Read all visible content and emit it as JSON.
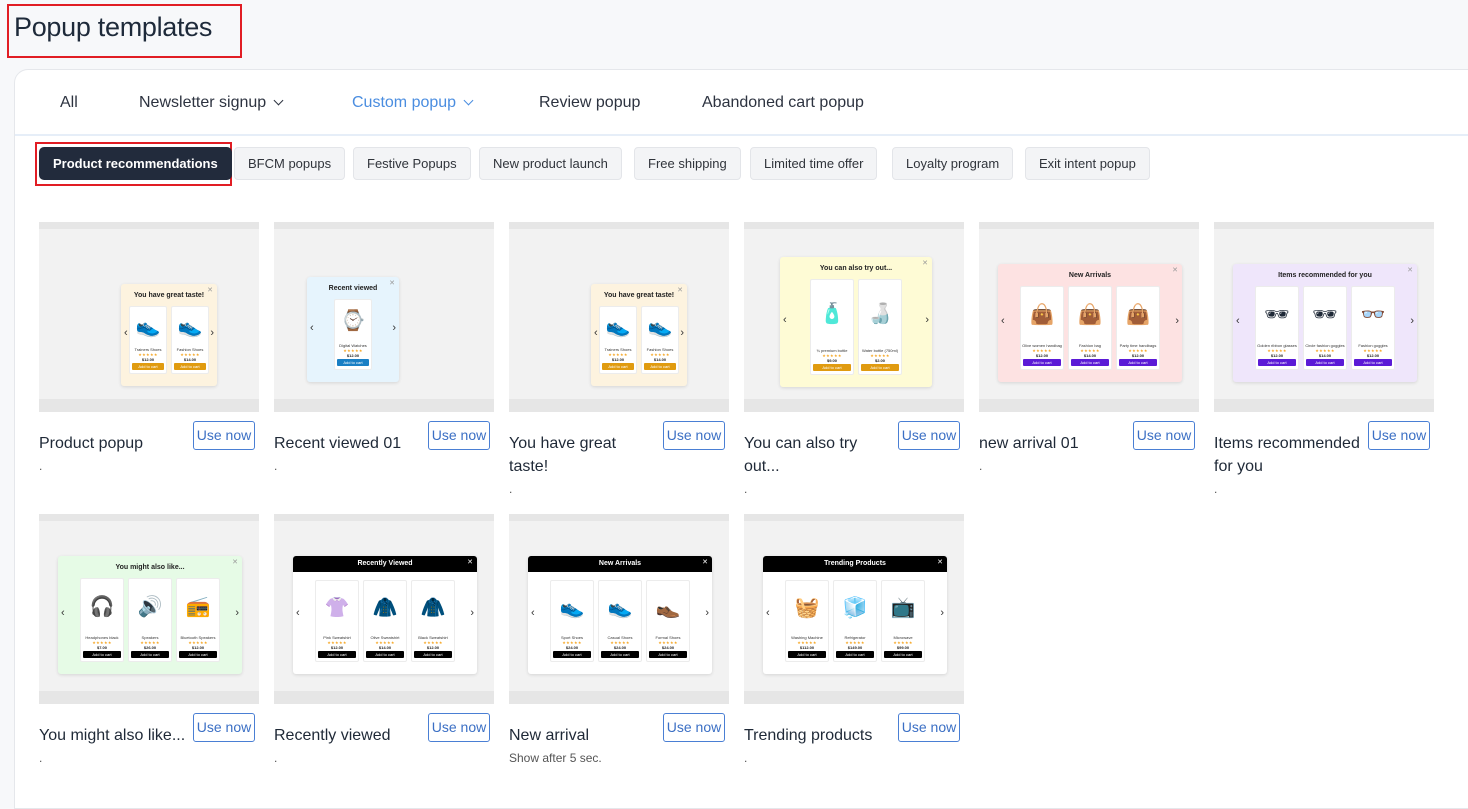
{
  "page_title": "Popup templates",
  "tabs": [
    {
      "label": "All",
      "active": false,
      "dropdown": false
    },
    {
      "label": "Newsletter signup",
      "active": false,
      "dropdown": true
    },
    {
      "label": "Custom popup",
      "active": true,
      "dropdown": true
    },
    {
      "label": "Review popup",
      "active": false,
      "dropdown": false
    },
    {
      "label": "Abandoned cart popup",
      "active": false,
      "dropdown": false
    }
  ],
  "chips": [
    {
      "label": "Product recommendations",
      "active": true
    },
    {
      "label": "BFCM popups",
      "active": false
    },
    {
      "label": "Festive Popups",
      "active": false
    },
    {
      "label": "New product launch",
      "active": false
    },
    {
      "label": "Free shipping",
      "active": false
    },
    {
      "label": "Limited time offer",
      "active": false
    },
    {
      "label": "Loyalty program",
      "active": false
    },
    {
      "label": "Exit intent popup",
      "active": false
    }
  ],
  "use_label": "Use now",
  "cards": [
    {
      "name": "Product popup",
      "desc": ".",
      "preview": {
        "title": "You have great taste!",
        "bg": "#fdf3df",
        "btn": "#e09b10",
        "products": [
          {
            "name": "Trainers Shoes",
            "price": "$12.00",
            "icon": "👟"
          },
          {
            "name": "Fashion Shoes",
            "price": "$14.00",
            "icon": "👟"
          }
        ],
        "button": "Add to cart"
      }
    },
    {
      "name": "Recent viewed 01",
      "desc": ".",
      "preview": {
        "title": "Recent viewed",
        "bg": "#e6f4fd",
        "btn": "#1a7fc4",
        "products": [
          {
            "name": "Digital Watches",
            "price": "$12.00",
            "icon": "⌚"
          }
        ],
        "button": "Add to cart"
      }
    },
    {
      "name": "You have great taste!",
      "desc": ".",
      "preview": {
        "title": "You have great taste!",
        "bg": "#fdf3df",
        "btn": "#e09b10",
        "products": [
          {
            "name": "Trainers Shoes",
            "price": "$12.00",
            "icon": "👟"
          },
          {
            "name": "Fashion Shoes",
            "price": "$14.00",
            "icon": "👟"
          }
        ],
        "button": "Add to cart"
      }
    },
    {
      "name": "You can also try out...",
      "desc": ".",
      "preview": {
        "title": "You can also try out...",
        "bg": "#fefbd5",
        "btn": "#e09b10",
        "products": [
          {
            "name": "¾ premium bottle",
            "price": "$9.00",
            "icon": "🧴"
          },
          {
            "name": "Water bottle (750ml)",
            "price": "$2.00",
            "icon": "🍶"
          }
        ],
        "button": "Add to cart"
      }
    },
    {
      "name": "new arrival 01",
      "desc": ".",
      "preview": {
        "title": "New Arrivals",
        "bg": "#fde2e2",
        "btn": "#5b1ad6",
        "products": [
          {
            "name": "Olive women handbag",
            "price": "$12.00",
            "icon": "👜"
          },
          {
            "name": "Fashion bag",
            "price": "$14.00",
            "icon": "👜"
          },
          {
            "name": "Party time handbags",
            "price": "$12.00",
            "icon": "👜"
          }
        ],
        "button": "Add to cart"
      }
    },
    {
      "name": "Items recommended for you",
      "desc": ".",
      "preview": {
        "title": "Items recommended for you",
        "bg": "#efe6fb",
        "btn": "#5b1ad6",
        "products": [
          {
            "name": "Golden ribbon glasses",
            "price": "$12.00",
            "icon": "🕶"
          },
          {
            "name": "Circle fashion goggles",
            "price": "$14.00",
            "icon": "🕶"
          },
          {
            "name": "Fashion goggles",
            "price": "$12.00",
            "icon": "👓"
          }
        ],
        "button": "Add to cart"
      }
    },
    {
      "name": "You might also like...",
      "desc": ".",
      "preview": {
        "title": "You might also like...",
        "bg": "#e6fbe6",
        "btn": "#000000",
        "products": [
          {
            "name": "Headphones black",
            "price": "$7.00",
            "icon": "🎧"
          },
          {
            "name": "Speakers",
            "price": "$26.00",
            "icon": "🔊"
          },
          {
            "name": "Bluetooth Speakers",
            "price": "$12.00",
            "icon": "📻"
          }
        ],
        "button": "Add to cart"
      }
    },
    {
      "name": "Recently viewed",
      "desc": ".",
      "preview": {
        "title": "Recently Viewed",
        "bg": "#ffffff",
        "btn": "#000000",
        "dark": true,
        "products": [
          {
            "name": "Pink Sweatshirt",
            "price": "$12.00",
            "icon": "👚"
          },
          {
            "name": "Olive Sweatshirt",
            "price": "$14.00",
            "icon": "🧥"
          },
          {
            "name": "Black Sweatshirt",
            "price": "$12.00",
            "icon": "🧥"
          }
        ],
        "button": "Add to cart"
      }
    },
    {
      "name": "New arrival",
      "desc": "Show after 5 sec.",
      "preview": {
        "title": "New Arrivals",
        "bg": "#ffffff",
        "btn": "#000000",
        "dark": true,
        "products": [
          {
            "name": "Sport Shoes",
            "price": "$24.00",
            "icon": "👟"
          },
          {
            "name": "Casual Shoes",
            "price": "$24.00",
            "icon": "👟"
          },
          {
            "name": "Formal Shoes",
            "price": "$24.00",
            "icon": "👞"
          }
        ],
        "button": "Add to cart"
      }
    },
    {
      "name": "Trending products",
      "desc": ".",
      "preview": {
        "title": "Trending Products",
        "bg": "#ffffff",
        "btn": "#000000",
        "dark": true,
        "products": [
          {
            "name": "Washing Machine",
            "price": "$112.00",
            "icon": "🧺"
          },
          {
            "name": "Refrigerator",
            "price": "$149.00",
            "icon": "🧊"
          },
          {
            "name": "Microwave",
            "price": "$99.00",
            "icon": "📺"
          }
        ],
        "button": "Add to cart"
      }
    }
  ]
}
